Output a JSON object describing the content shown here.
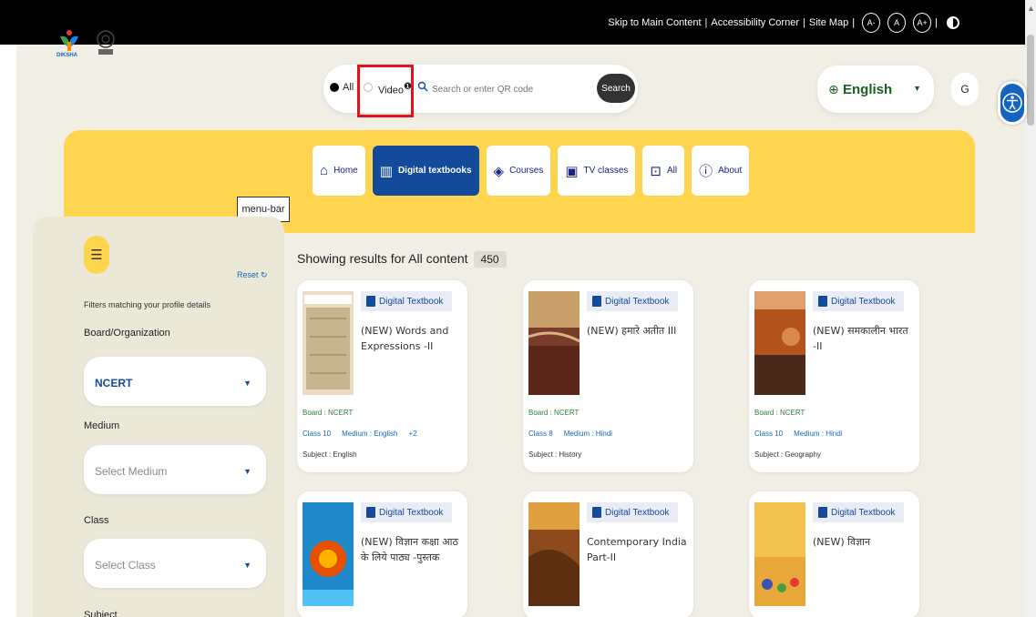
{
  "topbar": {
    "skip_link": "Skip to Main Content",
    "accessibility_link": "Accessibility Corner",
    "sitemap_link": "Site Map",
    "font_small": "A-",
    "font_normal": "A",
    "font_large": "A+"
  },
  "logo": {
    "label": "DIKSHA"
  },
  "search": {
    "option_all": "All",
    "option_video": "Video",
    "placeholder": "Search or enter QR code",
    "button": "Search"
  },
  "language": {
    "label": "English"
  },
  "user": {
    "initial": "G"
  },
  "nav": [
    {
      "label": "Home",
      "icon": "home-icon"
    },
    {
      "label": "Digital textbooks",
      "icon": "book-icon"
    },
    {
      "label": "Courses",
      "icon": "courses-icon"
    },
    {
      "label": "TV classes",
      "icon": "tv-icon"
    },
    {
      "label": "All",
      "icon": "all-icon"
    },
    {
      "label": "About",
      "icon": "info-icon"
    }
  ],
  "tooltip": {
    "text": "menu-bar"
  },
  "filters": {
    "reset": "Reset",
    "profile_text": "Filters matching your profile details",
    "board_label": "Board/Organization",
    "board_value": "NCERT",
    "medium_label": "Medium",
    "medium_placeholder": "Select Medium",
    "class_label": "Class",
    "class_placeholder": "Select Class",
    "subject_label": "Subject"
  },
  "results": {
    "heading": "Showing results for All content",
    "count": "450"
  },
  "cards": [
    {
      "tag": "Digital Textbook",
      "title": "(NEW) Words and Expressions -II",
      "board": "Board : NCERT",
      "class": "Class 10",
      "medium": "Medium : English",
      "extra": "+2",
      "subject": "Subject : English"
    },
    {
      "tag": "Digital Textbook",
      "title": "(NEW) हमारे अतीत III",
      "board": "Board : NCERT",
      "class": "Class 8",
      "medium": "Medium : Hindi",
      "extra": "",
      "subject": "Subject : History"
    },
    {
      "tag": "Digital Textbook",
      "title": "(NEW) समकालीन भारत -II",
      "board": "Board : NCERT",
      "class": "Class 10",
      "medium": "Medium : Hindi",
      "extra": "",
      "subject": "Subject : Geography"
    },
    {
      "tag": "Digital Textbook",
      "title": "(NEW) विज्ञान कक्षा आठ के लिये पाठ्य -पुस्तक"
    },
    {
      "tag": "Digital Textbook",
      "title": "Contemporary India Part-II"
    },
    {
      "tag": "Digital Textbook",
      "title": "(NEW) विज्ञान"
    }
  ]
}
